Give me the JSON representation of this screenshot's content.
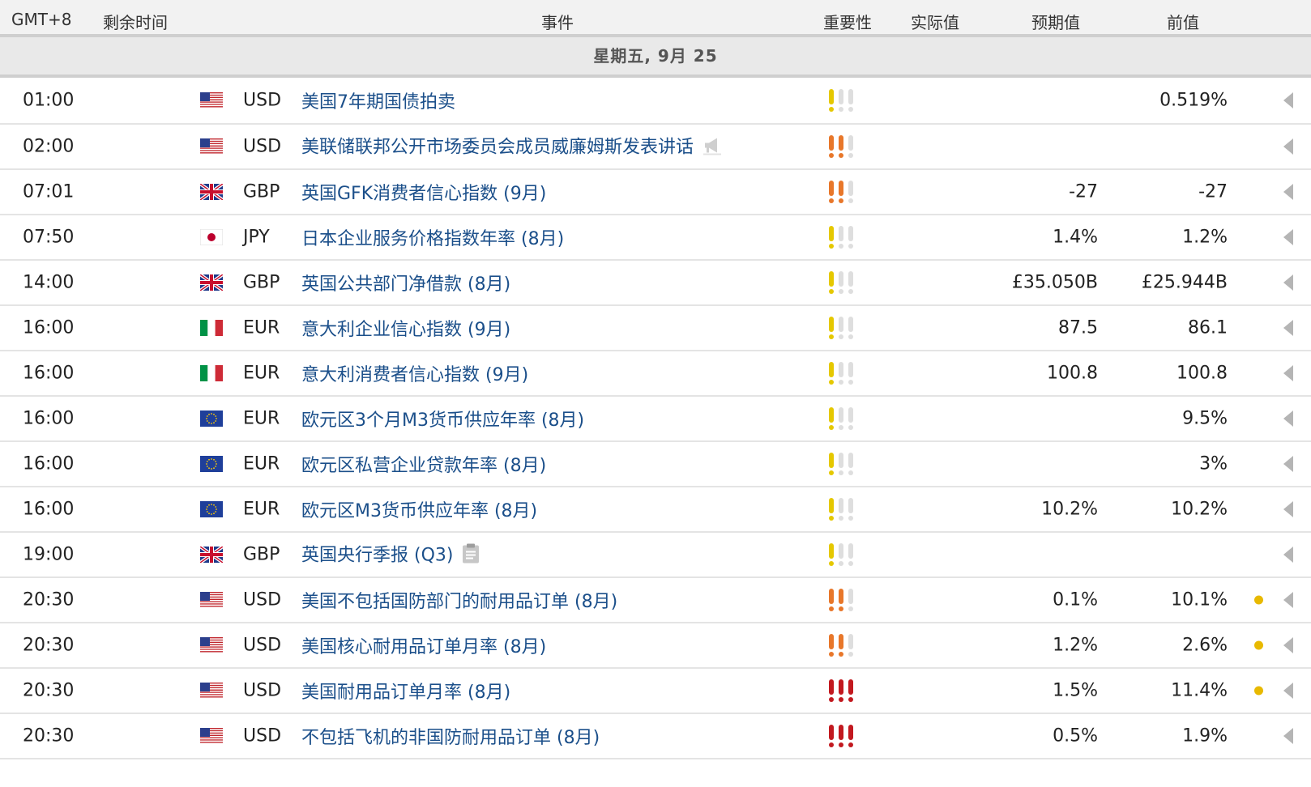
{
  "header": {
    "tz": "GMT+8",
    "remaining": "剩余时间",
    "event": "事件",
    "importance": "重要性",
    "actual": "实际值",
    "forecast": "预期值",
    "previous": "前值"
  },
  "date_label": "星期五, 9月 25",
  "colors": {
    "low": "#e5c800",
    "medium": "#e8772a",
    "high": "#c2191f",
    "inactive": "#dedede",
    "link": "#1b4f8a"
  },
  "rows": [
    {
      "time": "01:00",
      "flag": "us",
      "currency": "USD",
      "event": "美国7年期国债拍卖",
      "importance": 1,
      "forecast": "",
      "previous": "0.519%",
      "dot": false,
      "icon": ""
    },
    {
      "time": "02:00",
      "flag": "us",
      "currency": "USD",
      "event": "美联储联邦公开市场委员会成员威廉姆斯发表讲话",
      "importance": 2,
      "forecast": "",
      "previous": "",
      "dot": false,
      "icon": "megaphone-icon"
    },
    {
      "time": "07:01",
      "flag": "gb",
      "currency": "GBP",
      "event": "英国GFK消费者信心指数 (9月)",
      "importance": 2,
      "forecast": "-27",
      "previous": "-27",
      "dot": false,
      "icon": ""
    },
    {
      "time": "07:50",
      "flag": "jp",
      "currency": "JPY",
      "event": "日本企业服务价格指数年率 (8月)",
      "importance": 1,
      "forecast": "1.4%",
      "previous": "1.2%",
      "dot": false,
      "icon": ""
    },
    {
      "time": "14:00",
      "flag": "gb",
      "currency": "GBP",
      "event": "英国公共部门净借款 (8月)",
      "importance": 1,
      "forecast": "£35.050B",
      "previous": "£25.944B",
      "dot": false,
      "icon": ""
    },
    {
      "time": "16:00",
      "flag": "it",
      "currency": "EUR",
      "event": "意大利企业信心指数 (9月)",
      "importance": 1,
      "forecast": "87.5",
      "previous": "86.1",
      "dot": false,
      "icon": ""
    },
    {
      "time": "16:00",
      "flag": "it",
      "currency": "EUR",
      "event": "意大利消费者信心指数 (9月)",
      "importance": 1,
      "forecast": "100.8",
      "previous": "100.8",
      "dot": false,
      "icon": ""
    },
    {
      "time": "16:00",
      "flag": "eu",
      "currency": "EUR",
      "event": "欧元区3个月M3货币供应年率 (8月)",
      "importance": 1,
      "forecast": "",
      "previous": "9.5%",
      "dot": false,
      "icon": ""
    },
    {
      "time": "16:00",
      "flag": "eu",
      "currency": "EUR",
      "event": "欧元区私营企业贷款年率 (8月)",
      "importance": 1,
      "forecast": "",
      "previous": "3%",
      "dot": false,
      "icon": ""
    },
    {
      "time": "16:00",
      "flag": "eu",
      "currency": "EUR",
      "event": "欧元区M3货币供应年率 (8月)",
      "importance": 1,
      "forecast": "10.2%",
      "previous": "10.2%",
      "dot": false,
      "icon": ""
    },
    {
      "time": "19:00",
      "flag": "gb",
      "currency": "GBP",
      "event": "英国央行季报 (Q3)",
      "importance": 1,
      "forecast": "",
      "previous": "",
      "dot": false,
      "icon": "report-icon"
    },
    {
      "time": "20:30",
      "flag": "us",
      "currency": "USD",
      "event": "美国不包括国防部门的耐用品订单 (8月)",
      "importance": 2,
      "forecast": "0.1%",
      "previous": "10.1%",
      "dot": true,
      "icon": ""
    },
    {
      "time": "20:30",
      "flag": "us",
      "currency": "USD",
      "event": "美国核心耐用品订单月率 (8月)",
      "importance": 2,
      "forecast": "1.2%",
      "previous": "2.6%",
      "dot": true,
      "icon": ""
    },
    {
      "time": "20:30",
      "flag": "us",
      "currency": "USD",
      "event": "美国耐用品订单月率 (8月)",
      "importance": 3,
      "forecast": "1.5%",
      "previous": "11.4%",
      "dot": true,
      "icon": ""
    },
    {
      "time": "20:30",
      "flag": "us",
      "currency": "USD",
      "event": "不包括飞机的非国防耐用品订单 (8月)",
      "importance": 3,
      "forecast": "0.5%",
      "previous": "1.9%",
      "dot": false,
      "icon": ""
    }
  ]
}
